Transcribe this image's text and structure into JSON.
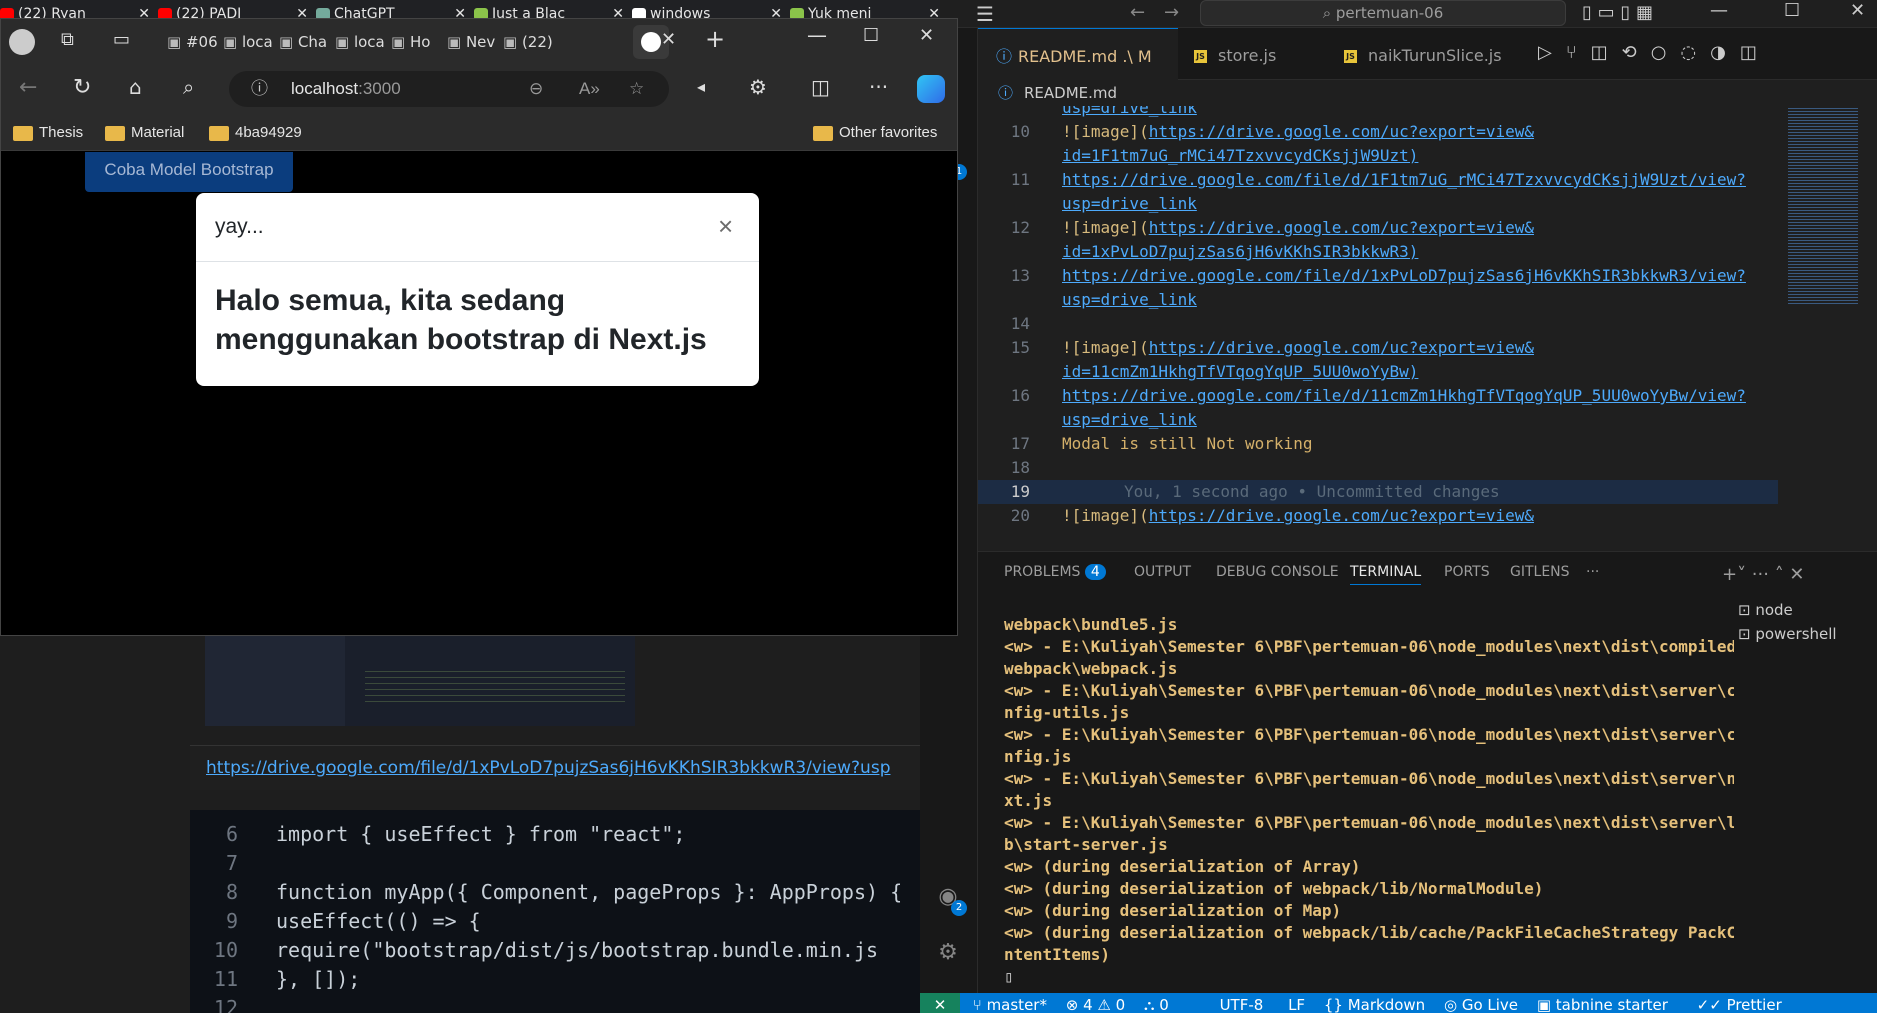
{
  "chrome_tabs": [
    {
      "label": "(22) Ryan",
      "color": "#ff0000"
    },
    {
      "label": "(22) PADI",
      "color": "#ff0000"
    },
    {
      "label": "ChatGPT",
      "color": "#74aa9c"
    },
    {
      "label": "Just a Blac",
      "color": "#8bc34a"
    },
    {
      "label": "windows",
      "color": "#ffffff"
    },
    {
      "label": "Yuk meni",
      "color": "#8bc34a"
    }
  ],
  "browser": {
    "tabs": [
      {
        "label": "#06"
      },
      {
        "label": "loca"
      },
      {
        "label": "Cha"
      },
      {
        "label": "loca"
      },
      {
        "label": "Ho"
      },
      {
        "label": "Nev"
      },
      {
        "label": "(22)"
      }
    ],
    "url_host": "localhost",
    "url_port": ":3000",
    "favorites": [
      "Thesis",
      "Material",
      "4ba94929"
    ],
    "other_favorites": "Other favorites",
    "trigger_button": "Coba Model Bootstrap",
    "modal": {
      "title": "yay...",
      "close": "×",
      "body": "Halo semua, kita sedang menggunakan bootstrap di Next.js"
    }
  },
  "background": {
    "link": "https://drive.google.com/file/d/1xPvLoD7pujzSas6jH6vKKhSIR3bkkwR3/view?usp",
    "code": [
      {
        "n": "6",
        "text": "import { useEffect } from \"react\";"
      },
      {
        "n": "7",
        "text": ""
      },
      {
        "n": "8",
        "text": "function myApp({ Component, pageProps }: AppProps) {"
      },
      {
        "n": "9",
        "text": "  useEffect(() => {"
      },
      {
        "n": "10",
        "text": "    require(\"bootstrap/dist/js/bootstrap.bundle.min.js"
      },
      {
        "n": "11",
        "text": "  }, []);"
      },
      {
        "n": "12",
        "text": ""
      }
    ]
  },
  "vscode": {
    "search": "pertemuan-06",
    "tabs": [
      {
        "label": "README.md .\\ M"
      },
      {
        "label": "store.js"
      },
      {
        "label": "naikTurunSlice.js"
      }
    ],
    "breadcrumb": "README.md",
    "code_lines": [
      {
        "n": "",
        "text": "usp=drive_link",
        "kind": "link"
      },
      {
        "n": "10",
        "text": "![image](https://drive.google.com/uc?export=view&",
        "kind": "img"
      },
      {
        "n": "",
        "text": "id=1F1tm7uG_rMCi47TzxvvcydCKsjjW9Uzt)",
        "kind": "link"
      },
      {
        "n": "11",
        "text": "https://drive.google.com/file/d/1F1tm7uG_rMCi47TzxvvcydCKsjjW9Uzt/view?",
        "kind": "link"
      },
      {
        "n": "",
        "text": "usp=drive_link",
        "kind": "link"
      },
      {
        "n": "12",
        "text": "![image](https://drive.google.com/uc?export=view&",
        "kind": "img"
      },
      {
        "n": "",
        "text": "id=1xPvLoD7pujzSas6jH6vKKhSIR3bkkwR3)",
        "kind": "link"
      },
      {
        "n": "13",
        "text": "https://drive.google.com/file/d/1xPvLoD7pujzSas6jH6vKKhSIR3bkkwR3/view?",
        "kind": "link"
      },
      {
        "n": "",
        "text": "usp=drive_link",
        "kind": "link"
      },
      {
        "n": "14",
        "text": "",
        "kind": "plain"
      },
      {
        "n": "15",
        "text": "![image](https://drive.google.com/uc?export=view&",
        "kind": "img"
      },
      {
        "n": "",
        "text": "id=11cmZm1HkhgTfVTqogYqUP_5UU0woYyBw)",
        "kind": "link"
      },
      {
        "n": "16",
        "text": "https://drive.google.com/file/d/11cmZm1HkhgTfVTqogYqUP_5UU0woYyBw/view?",
        "kind": "link"
      },
      {
        "n": "",
        "text": "usp=drive_link",
        "kind": "link"
      },
      {
        "n": "17",
        "text": "Modal is still Not working",
        "kind": "plain"
      },
      {
        "n": "18",
        "text": "",
        "kind": "plain"
      },
      {
        "n": "19",
        "text": "You, 1 second ago • Uncommitted changes",
        "kind": "blame"
      },
      {
        "n": "20",
        "text": "![image](https://drive.google.com/uc?export=view&",
        "kind": "img"
      }
    ],
    "panel_tabs": [
      "PROBLEMS",
      "OUTPUT",
      "DEBUG CONSOLE",
      "TERMINAL",
      "PORTS",
      "GITLENS"
    ],
    "problems_count": "4",
    "terminal_list": [
      "node",
      "powershell"
    ],
    "terminal_lines": [
      "webpack\\bundle5.js",
      "<w> - E:\\Kuliyah\\Semester 6\\PBF\\pertemuan-06\\node_modules\\next\\dist\\compiled\\",
      "webpack\\webpack.js",
      "<w> - E:\\Kuliyah\\Semester 6\\PBF\\pertemuan-06\\node_modules\\next\\dist\\server\\co",
      "nfig-utils.js",
      "<w> - E:\\Kuliyah\\Semester 6\\PBF\\pertemuan-06\\node_modules\\next\\dist\\server\\co",
      "nfig.js",
      "<w> - E:\\Kuliyah\\Semester 6\\PBF\\pertemuan-06\\node_modules\\next\\dist\\server\\ne",
      "xt.js",
      "<w> - E:\\Kuliyah\\Semester 6\\PBF\\pertemuan-06\\node_modules\\next\\dist\\server\\li",
      "b\\start-server.js",
      "<w> (during deserialization of Array)",
      "<w> (during deserialization of webpack/lib/NormalModule)",
      "<w> (during deserialization of Map)",
      "<w> (during deserialization of webpack/lib/cache/PackFileCacheStrategy PackCo",
      "ntentItems)"
    ],
    "status": {
      "branch": "master*",
      "errors": "4",
      "warnings": "0",
      "ports": "0",
      "encoding": "UTF-8",
      "eol": "LF",
      "language": "Markdown",
      "golive": "Go Live",
      "tabnine": "tabnine starter",
      "prettier": "Prettier"
    },
    "badges": {
      "source_control": "1",
      "accounts": "2"
    }
  }
}
